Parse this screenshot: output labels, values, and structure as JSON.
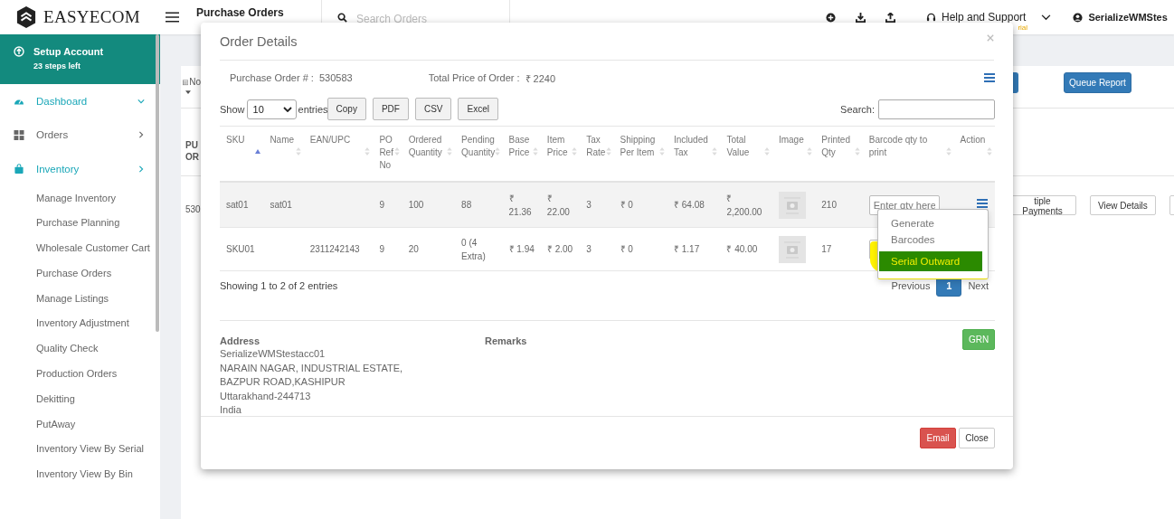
{
  "topbar": {
    "logo_text": "EASYECOM",
    "page_title": "Purchase Orders",
    "search": {
      "placeholder": "Search Orders"
    },
    "help": "Help and Support",
    "trial_note": "rial",
    "user": "SerializeWMStes"
  },
  "sidebar": {
    "setup": {
      "title": "Setup Account",
      "subtitle": "23 steps left"
    },
    "items": [
      {
        "label": "Dashboard",
        "highlighted": true,
        "expanded": true
      },
      {
        "label": "Orders",
        "highlighted": false,
        "expanded": false
      },
      {
        "label": "Inventory",
        "highlighted": true,
        "expanded": false,
        "children": [
          {
            "label": "Manage Inventory"
          },
          {
            "label": "Purchase Planning"
          },
          {
            "label": "Wholesale Customer Cart"
          },
          {
            "label": "Purchase Orders"
          },
          {
            "label": "Manage Listings"
          },
          {
            "label": "Inventory Adjustment"
          },
          {
            "label": "Quality Check"
          },
          {
            "label": "Production Orders"
          },
          {
            "label": "Dekitting"
          },
          {
            "label": "PutAway"
          },
          {
            "label": "Inventory View By Serial"
          },
          {
            "label": "Inventory View By Bin"
          }
        ]
      }
    ]
  },
  "background": {
    "filter_label": "No",
    "queue_button": "Queue Report",
    "column_header": "PU OR",
    "order_cell": "530",
    "row_buttons": [
      "tiple Payments",
      "View Details"
    ]
  },
  "modal": {
    "title": "Order Details",
    "po_label": "Purchase Order # :",
    "po_value": "530583",
    "total_label": "Total Price of Order :",
    "total_value": "₹ 2240",
    "show_label": "Show",
    "page_size": "10",
    "entries_label": "entries",
    "export_buttons": [
      "Copy",
      "PDF",
      "CSV",
      "Excel"
    ],
    "search_label": "Search:",
    "columns": [
      {
        "label": "SKU",
        "kind": "text",
        "sorted": true
      },
      {
        "label": "Name",
        "kind": "text",
        "sorted": false
      },
      {
        "label": "EAN/UPC",
        "kind": "text",
        "sorted": false
      },
      {
        "label": "PO Ref No",
        "kind": "text",
        "sorted": false
      },
      {
        "label": "Ordered Quantity",
        "kind": "text",
        "sorted": false
      },
      {
        "label": "Pending Quantity",
        "kind": "text",
        "sorted": false
      },
      {
        "label": "Base Price",
        "kind": "text",
        "sorted": false
      },
      {
        "label": "Item Price",
        "kind": "text",
        "sorted": false
      },
      {
        "label": "Tax Rate",
        "kind": "text",
        "sorted": false
      },
      {
        "label": "Shipping Per Item",
        "kind": "text",
        "sorted": false
      },
      {
        "label": "Included Tax",
        "kind": "text",
        "sorted": false
      },
      {
        "label": "Total Value",
        "kind": "text",
        "sorted": false
      },
      {
        "label": "Image",
        "kind": "image",
        "sorted": false
      },
      {
        "label": "Printed Qty",
        "kind": "text",
        "sorted": false
      },
      {
        "label": "Barcode qty to print",
        "kind": "field",
        "sorted": false
      },
      {
        "label": "Action",
        "kind": "menu",
        "sorted": false
      }
    ],
    "rows": [
      {
        "selected": true,
        "action_menu": true,
        "barcode_placeholder": "Enter qty here",
        "cells": [
          "sat01",
          "sat01",
          null,
          "9",
          "100",
          "88",
          "₹ 21.36",
          "₹ 22.00",
          "3",
          "₹ 0",
          "₹ 64.08",
          "₹ 2,200.00",
          null,
          "210",
          null,
          null
        ]
      },
      {
        "selected": false,
        "cells": [
          "SKU01",
          null,
          "2311242143",
          "9",
          "20",
          "0 (4 Extra)",
          "₹ 1.94",
          "₹ 2.00",
          "3",
          "₹ 0",
          "₹ 1.17",
          "₹ 40.00",
          null,
          "17",
          null,
          null
        ]
      }
    ],
    "info": "Showing 1 to 2 of 2 entries",
    "pagination": {
      "previous": "Previous",
      "pages": [
        {
          "label": "1",
          "selected": true
        }
      ],
      "next": "Next"
    },
    "address_label": "Address",
    "address_lines": [
      "SerializeWMStestacc01",
      "NARAIN NAGAR, INDUSTRIAL ESTATE, BAZPUR ROAD,KASHIPUR",
      "Uttarakhand-244713",
      "India"
    ],
    "remarks_label": "Remarks",
    "grn_button": "GRN",
    "email_button": "Email",
    "close_button": "Close",
    "action_menu": {
      "items": [
        {
          "label": "Generate Barcodes",
          "selected": false
        },
        {
          "label": "Serial Outward",
          "selected": true
        }
      ]
    }
  }
}
